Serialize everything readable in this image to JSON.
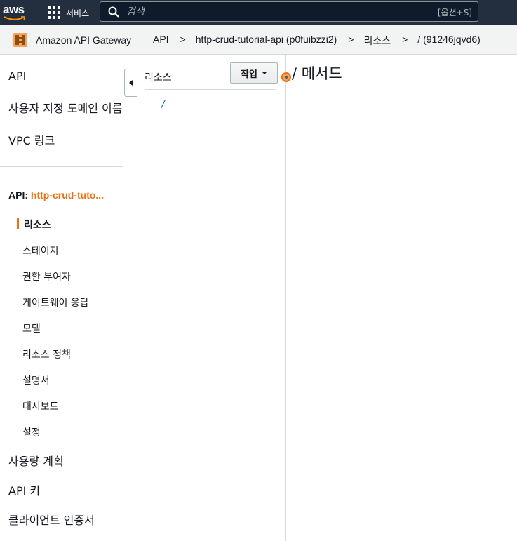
{
  "topnav": {
    "logo_text": "aws",
    "services_label": "서비스",
    "search_placeholder": "검색",
    "search_shortcut": "[옵션+S]"
  },
  "breadcrumbbar": {
    "service_name": "Amazon API Gateway",
    "crumbs": [
      "API",
      "http-crud-tutorial-api (p0fuibzzi2)",
      "리소스",
      "/ (91246jqvd6)"
    ],
    "separator": ">"
  },
  "sidebar": {
    "top_items": [
      "API",
      "사용자 지정 도메인 이름",
      "VPC 링크"
    ],
    "api_prefix": "API:",
    "api_name": "http-crud-tuto...",
    "sub_items": [
      "리소스",
      "스테이지",
      "권한 부여자",
      "게이트웨이 응답",
      "모델",
      "리소스 정책",
      "설명서",
      "대시보드",
      "설정"
    ],
    "bottom_items": [
      "사용량 계획",
      "API 키",
      "클라이언트 인증서"
    ]
  },
  "resources_panel": {
    "header": "리소스",
    "actions_label": "작업",
    "root_resource": "/"
  },
  "main": {
    "title": "/ 메서드"
  },
  "colors": {
    "topnav_bg": "#232f3e",
    "accent": "#ec7211",
    "link": "#0073bb"
  }
}
